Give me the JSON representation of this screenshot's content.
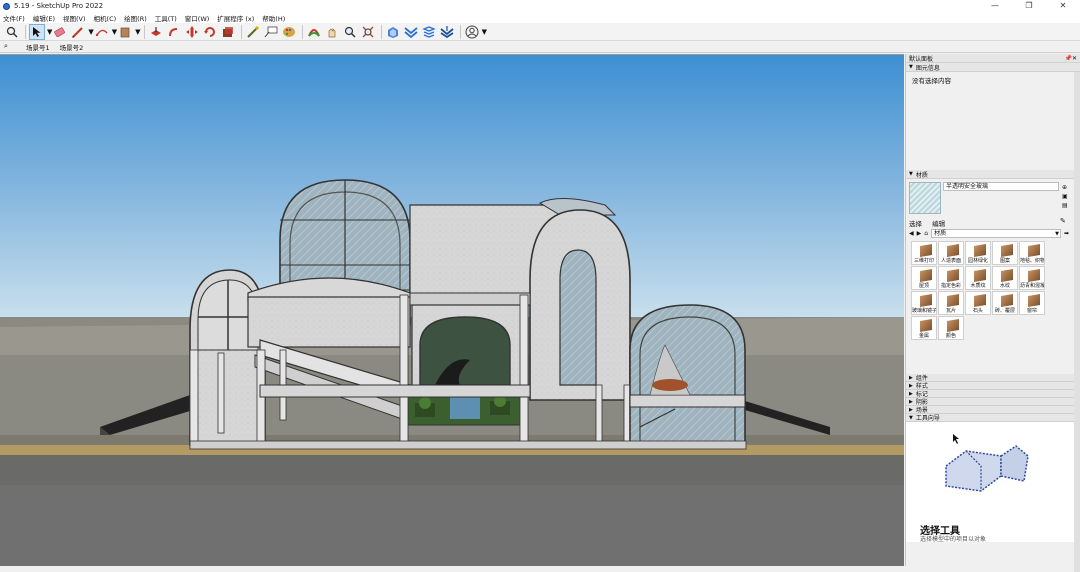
{
  "window": {
    "title": "5.19 - SketchUp Pro 2022",
    "controls": [
      "—",
      "❐",
      "✕"
    ]
  },
  "menu": [
    "文件(F)",
    "编辑(E)",
    "视图(V)",
    "相机(C)",
    "绘图(R)",
    "工具(T)",
    "窗口(W)",
    "扩展程序 (x)",
    "帮助(H)"
  ],
  "scenes": {
    "tabs": [
      "场景号1",
      "场景号2"
    ]
  },
  "tray": {
    "title": "默认面板",
    "entity_info": {
      "header": "图元信息",
      "text": "没有选择内容"
    },
    "materials": {
      "header": "材质",
      "current_name": "半透明安全玻璃",
      "tabs": [
        "选择",
        "编辑"
      ],
      "library": "材质",
      "swatches": [
        "三维打印",
        "人造表面",
        "园林绿化",
        "图案",
        "地毯、织物",
        "屋顶",
        "指定色彩",
        "木质纹",
        "水纹",
        "沥青和混凝土",
        "玻璃和镜子",
        "瓦片",
        "石头",
        "砖、覆层",
        "窗帘",
        "金属",
        "颜色"
      ]
    },
    "collapsed": [
      "组件",
      "样式",
      "标记",
      "阴影",
      "场景"
    ],
    "instructor": {
      "header": "工具向导",
      "title": "选择工具",
      "subtitle": "选择模型中的项目以对象"
    }
  },
  "colors": {
    "sky_top": "#3e8fd2",
    "sky_bottom": "#cfe3ee",
    "ground": "#8a8a82",
    "accent": "#2a6fd6"
  }
}
